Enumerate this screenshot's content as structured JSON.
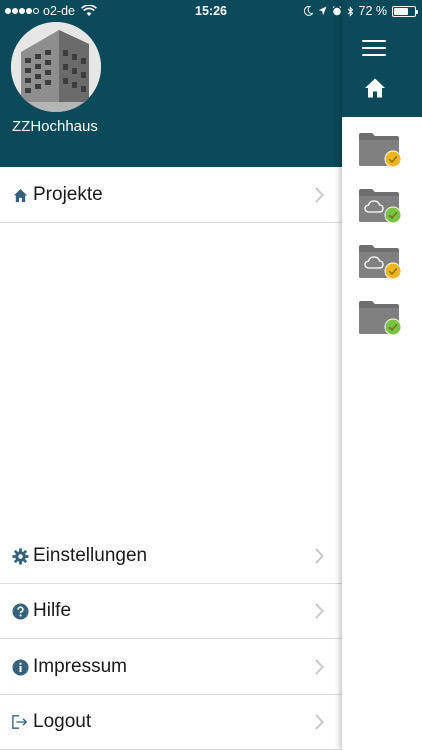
{
  "status_bar": {
    "carrier": "o2-de",
    "time": "15:26",
    "battery": "72 %",
    "battery_level": 0.72
  },
  "profile": {
    "name": "ZZHochhaus",
    "avatar_icon": "building-photo"
  },
  "menu": {
    "projects_label": "Projekte",
    "settings_label": "Einstellungen",
    "help_label": "Hilfe",
    "impressum_label": "Impressum",
    "logout_label": "Logout"
  },
  "rail": {
    "folders": [
      {
        "icon": "folder-icon",
        "badge": "check",
        "badge_color": "#f2b61d",
        "cloud": false
      },
      {
        "icon": "folder-cloud-icon",
        "badge": "check",
        "badge_color": "#7cc242",
        "cloud": true
      },
      {
        "icon": "folder-cloud-icon",
        "badge": "check",
        "badge_color": "#f2b61d",
        "cloud": true
      },
      {
        "icon": "folder-icon",
        "badge": "check",
        "badge_color": "#7cc242",
        "cloud": false
      }
    ]
  },
  "colors": {
    "header": "#0b4a5b",
    "icon": "#35627a",
    "chevron": "#c7c7cc"
  }
}
